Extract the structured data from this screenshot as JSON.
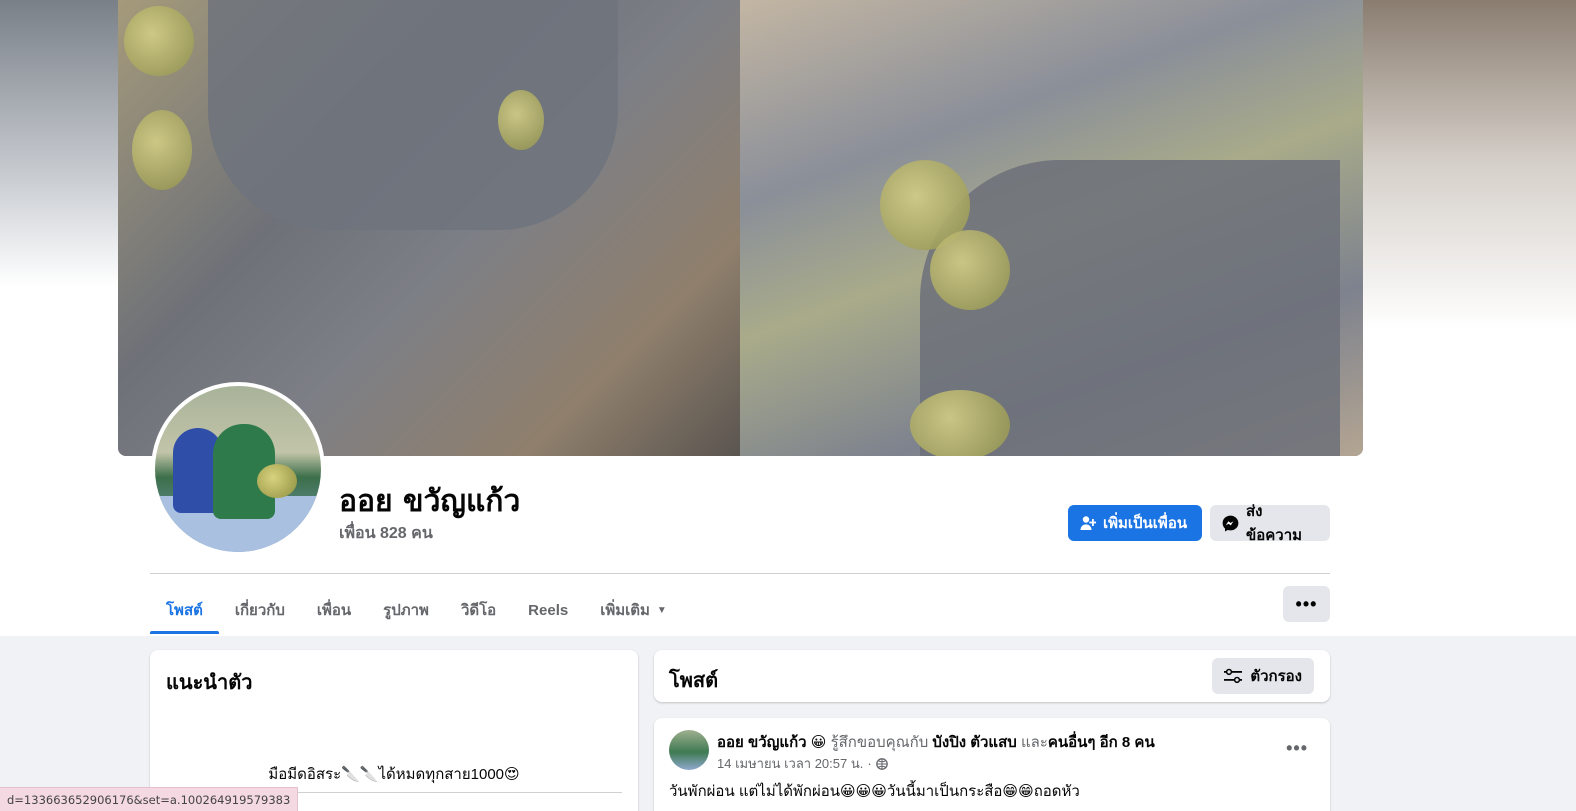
{
  "profile": {
    "name": "ออย ขวัญแก้ว",
    "friends": "เพื่อน 828 คน"
  },
  "actions": {
    "add_friend": "เพิ่มเป็นเพื่อน",
    "message": "ส่งข้อความ"
  },
  "tabs": [
    {
      "label": "โพสต์",
      "active": true
    },
    {
      "label": "เกี่ยวกับ"
    },
    {
      "label": "เพื่อน"
    },
    {
      "label": "รูปภาพ"
    },
    {
      "label": "วิดีโอ"
    },
    {
      "label": "Reels"
    },
    {
      "label": "เพิ่มเติม"
    }
  ],
  "intro": {
    "title": "แนะนำตัว",
    "bio": "มือมีดอิสระ🔪🔪ได้หมดทุกสาย1000😍"
  },
  "posts": {
    "title": "โพสต์",
    "filter": "ตัวกรอง"
  },
  "post": {
    "author": "ออย ขวัญแก้ว",
    "feeling_emoji": "😀",
    "feeling_text": "รู้สึกขอบคุณกับ",
    "tagged": "บังปิง ตัวแสบ",
    "and_text": "และ",
    "others": "คนอื่นๆ อีก 8 คน",
    "timestamp": "14 เมษายน เวลา 20:57 น.",
    "separator": "·",
    "text": "วันพักผ่อน แต่ไม่ได้พักผ่อน😀😀😀วันนี้มาเป็นกระสือ😁😁ถอดหัว"
  },
  "status_bar": {
    "url": "d=133663652906176&set=a.100264919579383"
  },
  "colors": {
    "accent": "#1b74e4",
    "secondary_bg": "#e4e6eb",
    "page_bg": "#f0f2f5",
    "muted_text": "#65676b"
  }
}
